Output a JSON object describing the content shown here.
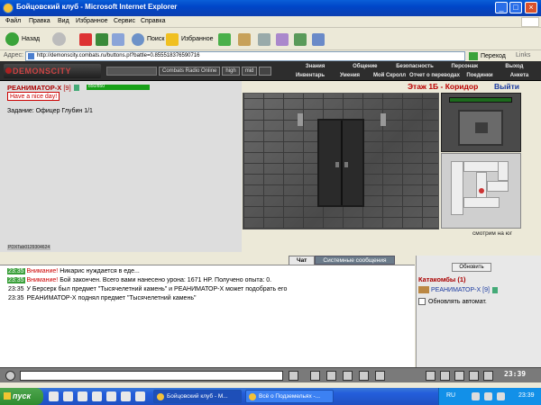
{
  "window": {
    "title": "Бойцовский клуб - Microsoft Internet Explorer"
  },
  "menu": {
    "items": [
      "Файл",
      "Правка",
      "Вид",
      "Избранное",
      "Сервис",
      "Справка"
    ]
  },
  "toolbar": {
    "back_label": "Назад",
    "search_label": "Поиск",
    "favorites_label": "Избранное"
  },
  "address": {
    "label": "Адрес:",
    "url": "http://demonscity.combats.ru/buttons.pl?battle=0.855518376590716",
    "go_label": "Переход",
    "links_label": "Links"
  },
  "game_header": {
    "logo_text": "DEMONSCITY",
    "radio_label": "Combats Radio Online",
    "quality": [
      "high",
      "mid"
    ],
    "nav_top": [
      "Знания",
      "Общение",
      "Безопасность",
      "Персонаж",
      "Выход"
    ],
    "nav_bottom": [
      "Инвентарь",
      "Умения",
      "Мой Скролл",
      "Отчет о переводах",
      "Поединки",
      "Анкета"
    ]
  },
  "character": {
    "name": "РЕАНИМАТОР-X",
    "level": "[9]",
    "hp": "850/850",
    "greeting": "Have a nice day!",
    "task": "Задание: Офицер Глубин 1/1",
    "client_code": "PDXTab0129304624"
  },
  "location": {
    "title": "Этаж 1Б - Коридор",
    "exit_label": "Выйти",
    "looking": "смотрим на юг"
  },
  "tabs": {
    "chat": "Чат",
    "system": "Системные сообщения"
  },
  "chat": [
    {
      "time": "23:35",
      "green": true,
      "warn": "Внимание!",
      "text": " Никарис нуждается в еде..."
    },
    {
      "time": "23:35",
      "green": true,
      "warn": "Внимание!",
      "text": " Бой закончен. Всего вами нанесено урона: 1671 HP. Получено опыта: 0."
    },
    {
      "time": "23:35",
      "green": false,
      "warn": "",
      "text": " У Берсерк был предмет \"Тысячелетний камень\" и РЕАНИМАТОР-X может подобрать его"
    },
    {
      "time": "23:35",
      "green": false,
      "warn": "",
      "text": " РЕАНИМАТОР-X поднял предмет \"Тысячелетний камень\""
    }
  ],
  "right_panel": {
    "refresh_label": "Обновить",
    "room": "Катакомбы (1)",
    "member_name": "РЕАНИМАТОР-X",
    "member_level": "[9]",
    "auto_label": "Обновлять автомат."
  },
  "chat_clock": "23:39",
  "taskbar": {
    "start_label": "пуск",
    "tasks": [
      "Бойцовский клуб - M...",
      "Всё о Подземельях -..."
    ],
    "lang": "RU",
    "time": "23:39"
  },
  "colors": {
    "accent_red": "#a00000",
    "hp_green": "#18a018",
    "link_blue": "#1a3aa0"
  }
}
